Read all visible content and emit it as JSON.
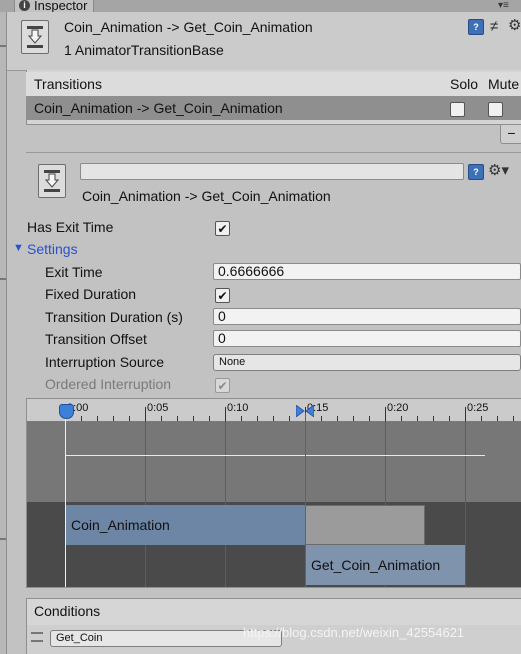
{
  "window": {
    "tab_label": "Inspector"
  },
  "header": {
    "title": "Coin_Animation -> Get_Coin_Animation",
    "subtitle": "1 AnimatorTransitionBase"
  },
  "transitions_list": {
    "header_label": "Transitions",
    "solo_label": "Solo",
    "mute_label": "Mute",
    "rows": [
      {
        "name": "Coin_Animation -> Get_Coin_Animation",
        "solo": false,
        "mute": false
      }
    ],
    "remove_button": "−"
  },
  "transition": {
    "name_field_value": "",
    "title": "Coin_Animation -> Get_Coin_Animation",
    "help_icon": "help-icon",
    "gear_icon": "gear-icon"
  },
  "properties": {
    "has_exit_time_label": "Has Exit Time",
    "has_exit_time": true,
    "settings_label": "Settings",
    "exit_time_label": "Exit Time",
    "exit_time_value": "0.6666666",
    "fixed_duration_label": "Fixed Duration",
    "fixed_duration": true,
    "transition_duration_label": "Transition Duration (s)",
    "transition_duration_value": "0",
    "transition_offset_label": "Transition Offset",
    "transition_offset_value": "0",
    "interruption_source_label": "Interruption Source",
    "interruption_source_value": "None",
    "ordered_interruption_label": "Ordered Interruption",
    "ordered_interruption": true
  },
  "timeline": {
    "tick_labels": [
      "0:00",
      "0:05",
      "0:10",
      "0:15",
      "0:20",
      "0:25"
    ],
    "source_clip": "Coin_Animation",
    "destination_clip": "Get_Coin_Animation"
  },
  "conditions": {
    "header_label": "Conditions",
    "rows": [
      {
        "parameter": "Get_Coin"
      }
    ]
  },
  "watermark": "https://blog.csdn.net/weixin_42554621",
  "colors": {
    "accent": "#2a52c9",
    "clip_source": "#6d86a6",
    "clip_destination": "#7f93ad",
    "selected_row": "#8f8f8f"
  }
}
